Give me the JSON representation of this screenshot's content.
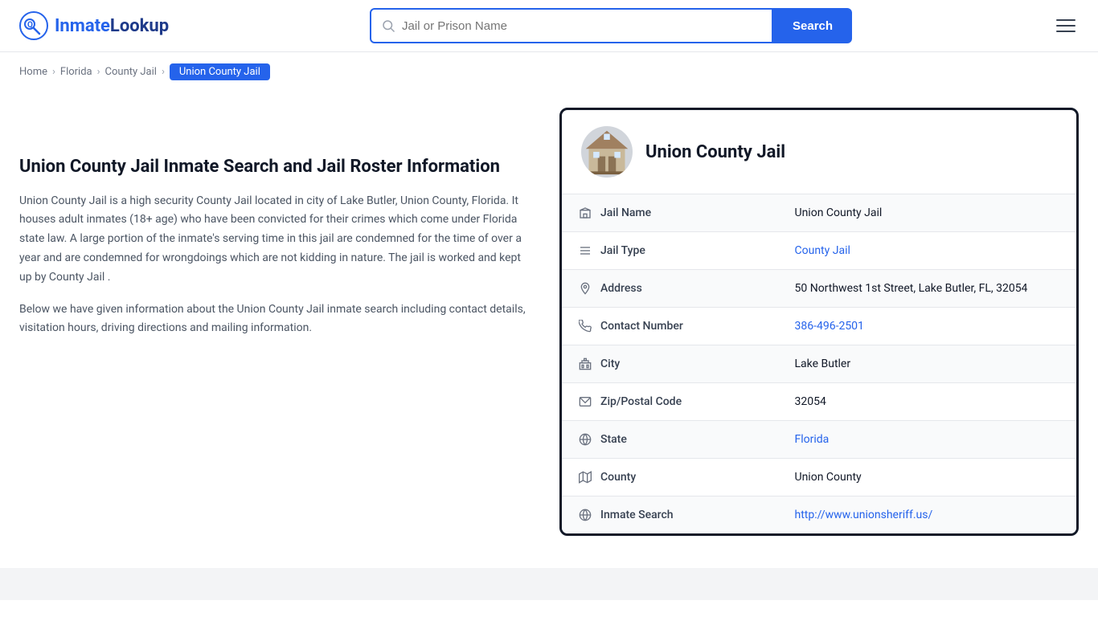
{
  "header": {
    "logo_text_1": "Inmate",
    "logo_text_2": "Lookup",
    "search_placeholder": "Jail or Prison Name",
    "search_button_label": "Search"
  },
  "breadcrumb": {
    "items": [
      {
        "label": "Home",
        "href": "#",
        "active": false
      },
      {
        "label": "Florida",
        "href": "#",
        "active": false
      },
      {
        "label": "County Jail",
        "href": "#",
        "active": false
      },
      {
        "label": "Union County Jail",
        "href": "#",
        "active": true
      }
    ]
  },
  "left": {
    "title": "Union County Jail Inmate Search and Jail Roster Information",
    "desc1": "Union County Jail is a high security County Jail located in city of Lake Butler, Union County, Florida. It houses adult inmates (18+ age) who have been convicted for their crimes which come under Florida state law. A large portion of the inmate's serving time in this jail are condemned for the time of over a year and are condemned for wrongdoings which are not kidding in nature. The jail is worked and kept up by County Jail .",
    "desc2": "Below we have given information about the Union County Jail inmate search including contact details, visitation hours, driving directions and mailing information."
  },
  "card": {
    "title": "Union County Jail",
    "rows": [
      {
        "icon": "building-icon",
        "label": "Jail Name",
        "value": "Union County Jail",
        "link": false
      },
      {
        "icon": "list-icon",
        "label": "Jail Type",
        "value": "County Jail",
        "link": true,
        "href": "#"
      },
      {
        "icon": "pin-icon",
        "label": "Address",
        "value": "50 Northwest 1st Street, Lake Butler, FL, 32054",
        "link": false
      },
      {
        "icon": "phone-icon",
        "label": "Contact Number",
        "value": "386-496-2501",
        "link": true,
        "href": "tel:386-496-2501"
      },
      {
        "icon": "city-icon",
        "label": "City",
        "value": "Lake Butler",
        "link": false
      },
      {
        "icon": "mail-icon",
        "label": "Zip/Postal Code",
        "value": "32054",
        "link": false
      },
      {
        "icon": "globe-icon",
        "label": "State",
        "value": "Florida",
        "link": true,
        "href": "#"
      },
      {
        "icon": "map-icon",
        "label": "County",
        "value": "Union County",
        "link": false
      },
      {
        "icon": "web-icon",
        "label": "Inmate Search",
        "value": "http://www.unionsheriff.us/",
        "link": true,
        "href": "http://www.unionsheriff.us/"
      }
    ]
  }
}
